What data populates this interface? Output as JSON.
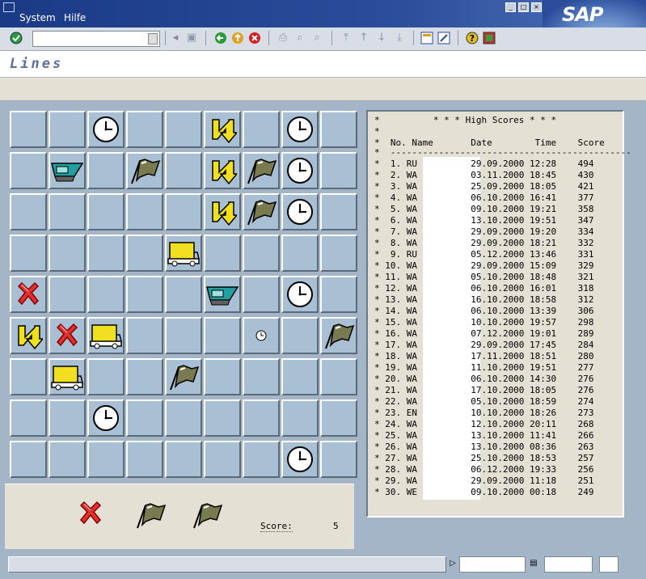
{
  "menu": {
    "system": "System",
    "help": "Hilfe"
  },
  "logo": "SAP",
  "window_buttons": [
    "_",
    "□",
    "×"
  ],
  "title": "Lines",
  "game": {
    "rows": 9,
    "cols": 9,
    "pieces": [
      {
        "r": 0,
        "c": 2,
        "t": "clock"
      },
      {
        "r": 0,
        "c": 5,
        "t": "bolt"
      },
      {
        "r": 0,
        "c": 7,
        "t": "clock"
      },
      {
        "r": 1,
        "c": 1,
        "t": "eraser"
      },
      {
        "r": 1,
        "c": 3,
        "t": "flag"
      },
      {
        "r": 1,
        "c": 5,
        "t": "bolt"
      },
      {
        "r": 1,
        "c": 6,
        "t": "flag"
      },
      {
        "r": 1,
        "c": 7,
        "t": "clock"
      },
      {
        "r": 2,
        "c": 5,
        "t": "bolt"
      },
      {
        "r": 2,
        "c": 6,
        "t": "flag"
      },
      {
        "r": 2,
        "c": 7,
        "t": "clock"
      },
      {
        "r": 3,
        "c": 4,
        "t": "truck"
      },
      {
        "r": 4,
        "c": 0,
        "t": "cross"
      },
      {
        "r": 4,
        "c": 5,
        "t": "eraser"
      },
      {
        "r": 4,
        "c": 7,
        "t": "clock"
      },
      {
        "r": 5,
        "c": 0,
        "t": "bolt"
      },
      {
        "r": 5,
        "c": 1,
        "t": "cross"
      },
      {
        "r": 5,
        "c": 2,
        "t": "truck"
      },
      {
        "r": 5,
        "c": 6,
        "t": "smallclock"
      },
      {
        "r": 5,
        "c": 8,
        "t": "flag"
      },
      {
        "r": 6,
        "c": 1,
        "t": "truck"
      },
      {
        "r": 6,
        "c": 4,
        "t": "flag"
      },
      {
        "r": 7,
        "c": 2,
        "t": "clock"
      },
      {
        "r": 8,
        "c": 7,
        "t": "clock"
      }
    ],
    "next_pieces": [
      "cross",
      "flag",
      "flag"
    ],
    "score_label": "Score:",
    "score_value": "5"
  },
  "highscores": {
    "header": "*          * * * High Scores * * *",
    "blank": "*",
    "columns": "*  No. Name       Date        Time    Score",
    "divider": "*  ---------------------------------------------",
    "rows": [
      "*  1. RU          29.09.2000 12:28    494",
      "*  2. WA          03.11.2000 18:45    430",
      "*  3. WA          25.09.2000 18:05    421",
      "*  4. WA          06.10.2000 16:41    377",
      "*  5. WA          09.10.2000 19:21    358",
      "*  6. WA          13.10.2000 19:51    347",
      "*  7. WA          29.09.2000 19:20    334",
      "*  8. WA          29.09.2000 18:21    332",
      "*  9. RU          05.12.2000 13:46    331",
      "* 10. WA          29.09.2000 15:09    329",
      "* 11. WA          05.10.2000 18:48    321",
      "* 12. WA          06.10.2000 16:01    318",
      "* 13. WA          16.10.2000 18:58    312",
      "* 14. WA          06.10.2000 13:39    306",
      "* 15. WA          10.10.2000 19:57    298",
      "* 16. WA          07.12.2000 19:01    289",
      "* 17. WA          29.09.2000 17:45    284",
      "* 18. WA          17.11.2000 18:51    280",
      "* 19. WA          11.10.2000 19:51    277",
      "* 20. WA          06.10.2000 14:30    276",
      "* 21. WA          17.10.2000 18:05    276",
      "* 22. WA          05.10.2000 18:59    274",
      "* 23. EN          10.10.2000 18:26    273",
      "* 24. WA          12.10.2000 20:11    268",
      "* 25. WA          13.10.2000 11:41    266",
      "* 26. WA          13.10.2000 08:36    263",
      "* 27. WA          25.10.2000 18:53    257",
      "* 28. WA          06.12.2000 19:33    256",
      "* 29. WA          29.09.2000 11:18    251",
      "* 30. WE          09.10.2000 00:18    249"
    ]
  }
}
